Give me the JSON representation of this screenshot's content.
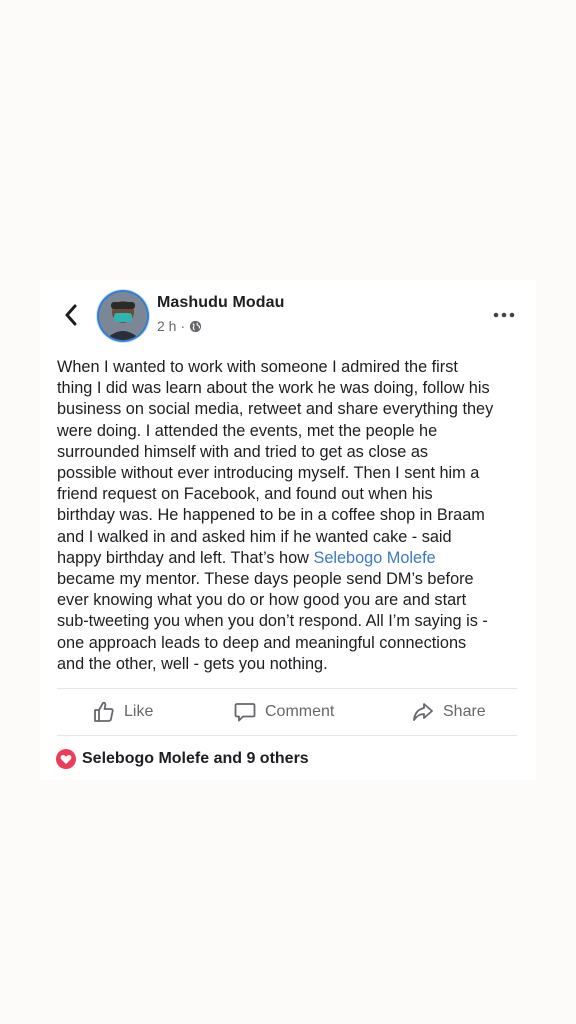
{
  "post": {
    "author": "Mashudu Modau",
    "time": "2 h",
    "separator": "·",
    "text_part1": "When I wanted to work with someone I admired the first\nthing I did was learn about the work he was doing, follow his\nbusiness on social media, retweet and share everything they\nwere doing. I attended the events, met the people he\nsurrounded himself with and tried to get as close as\npossible without ever introducing myself. Then I sent him a\nfriend request on Facebook, and found out when his\nbirthday was. He happened to be in a coffee shop in Braam\nand I walked in and asked him if he wanted cake - said\nhappy birthday and left. That’s how ",
    "mention": "Selebogo Molefe",
    "text_part2": "\nbecame my mentor. These days people send DM’s before\never knowing what you do or how good you are and start\nsub-tweeting you when you don’t respond. All I’m saying is -\none approach leads to deep and meaningful connections\nand the other, well - gets you nothing."
  },
  "actions": {
    "like": "Like",
    "comment": "Comment",
    "share": "Share"
  },
  "reactions": {
    "summary": "Selebogo Molefe and 9 others"
  },
  "colors": {
    "link": "#3b78c9",
    "heart": "#ec3c5a",
    "secondary_text": "#65676b"
  },
  "icons": [
    "back-chevron-icon",
    "globe-icon",
    "more-dots-icon",
    "like-thumb-icon",
    "comment-bubble-icon",
    "share-arrow-icon",
    "heart-icon"
  ]
}
